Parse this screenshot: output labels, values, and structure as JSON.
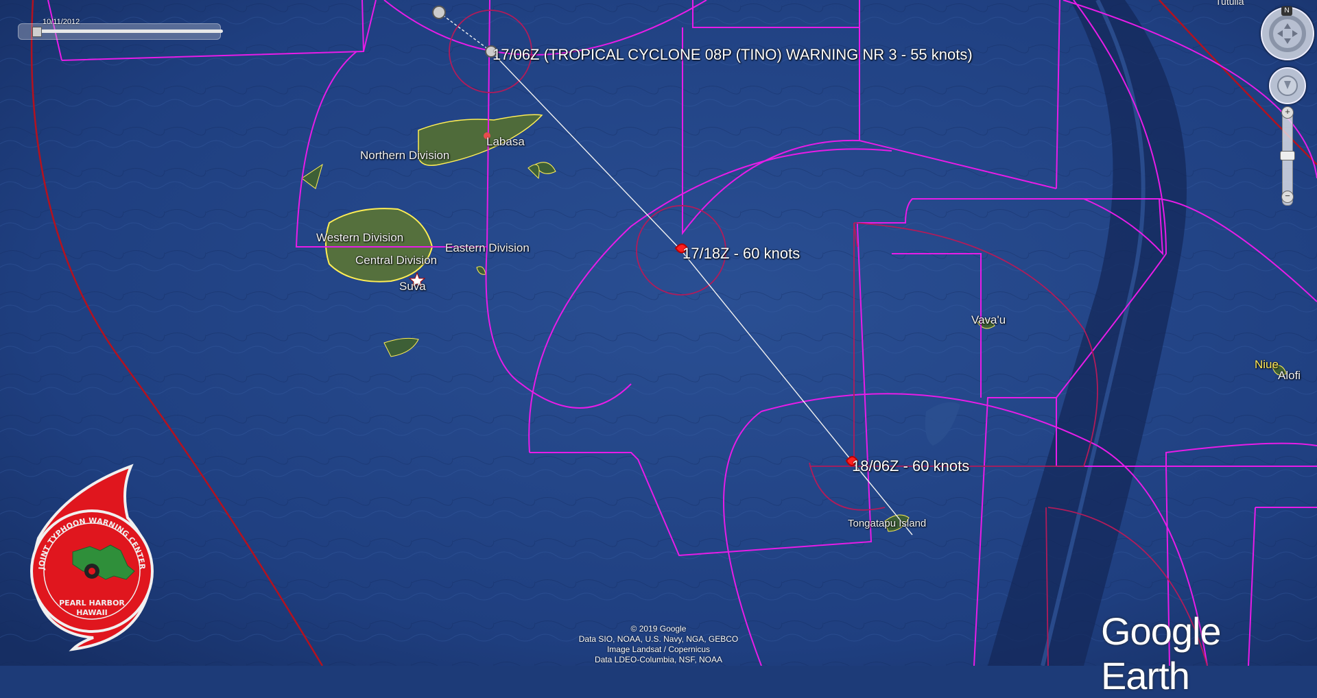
{
  "map": {
    "terrain_color": "#1d3b78",
    "warning_area_color": "#e81ce8",
    "radius_ring_color": "#b21b5a",
    "exclusion_line_color": "#b3121f"
  },
  "time_slider": {
    "date": "10/11/2012"
  },
  "warnings": {
    "w1": "17/06Z (TROPICAL CYCLONE 08P (TINO) WARNING NR 3    - 55 knots)",
    "w2": "17/18Z - 60 knots",
    "w3": "18/06Z - 60 knots"
  },
  "places": {
    "labasa": "Labasa",
    "northern": "Northern Division",
    "western": "Western Division",
    "eastern": "Eastern Division",
    "central": "Central Division",
    "suva": "Suva",
    "vavau": "Vava'u",
    "tongatapu": "Tongatapu Island",
    "niue": "Niue",
    "alofi": "Alofi",
    "tutuila": "Tutuila"
  },
  "nav": {
    "north_label": "N",
    "zoom_in": "+",
    "zoom_out": "−",
    "compass_icon": "compass-icon",
    "look_icon": "look-joystick-icon"
  },
  "attribution": {
    "line1": "© 2019 Google",
    "line2": "Data SIO, NOAA, U.S. Navy, NGA, GEBCO",
    "line3": "Image Landsat / Copernicus",
    "line4": "Data LDEO-Columbia, NSF, NOAA"
  },
  "brand": {
    "text": "Google Earth"
  },
  "logo": {
    "top_text": "JOINT TYPHOON WARNING CENTER",
    "line1": "PEARL HARBOR",
    "line2": "HAWAII",
    "color": "#e0161e"
  }
}
